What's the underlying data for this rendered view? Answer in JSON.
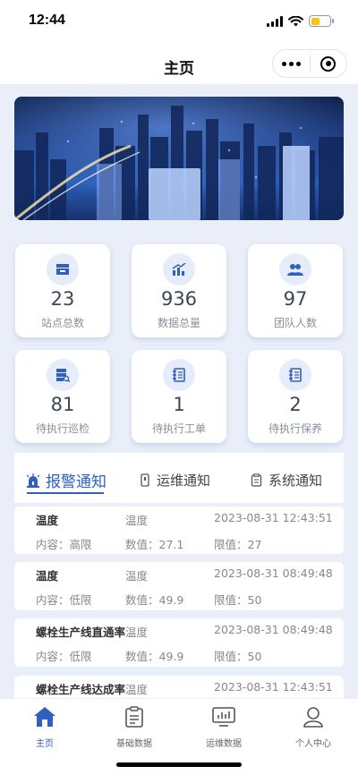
{
  "status_bar": {
    "time": "12:44"
  },
  "nav": {
    "title": "主页"
  },
  "stats": [
    {
      "value": "23",
      "label": "站点总数",
      "icon": "inbox-icon"
    },
    {
      "value": "936",
      "label": "数据总量",
      "icon": "chart-up-icon"
    },
    {
      "value": "97",
      "label": "团队人数",
      "icon": "team-icon"
    },
    {
      "value": "81",
      "label": "待执行巡检",
      "icon": "server-search-icon"
    },
    {
      "value": "1",
      "label": "待执行工单",
      "icon": "notebook-icon"
    },
    {
      "value": "2",
      "label": "待执行保养",
      "icon": "notebook-icon"
    }
  ],
  "notice_tabs": [
    {
      "label": "报警通知",
      "icon": "alarm-light-icon",
      "active": true
    },
    {
      "label": "运维通知",
      "icon": "phone-icon",
      "active": false
    },
    {
      "label": "系统通知",
      "icon": "clipboard-icon",
      "active": false
    }
  ],
  "notices": [
    {
      "title": "温度",
      "type": "温度",
      "time": "2023-08-31 12:43:51",
      "content": "内容：高限",
      "value": "数值：27.1",
      "limit": "限值：27"
    },
    {
      "title": "温度",
      "type": "温度",
      "time": "2023-08-31 08:49:48",
      "content": "内容：低限",
      "value": "数值：49.9",
      "limit": "限值：50"
    },
    {
      "title": "螺栓生产线直通率",
      "type": "温度",
      "time": "2023-08-31 08:49:48",
      "content": "内容：低限",
      "value": "数值：49.9",
      "limit": "限值：50"
    },
    {
      "title": "螺栓生产线达成率",
      "type": "温度",
      "time": "2023-08-31 12:43:51"
    }
  ],
  "tab_bar": [
    {
      "label": "主页",
      "icon": "home-icon",
      "active": true
    },
    {
      "label": "基础数据",
      "icon": "clipboard-icon",
      "active": false
    },
    {
      "label": "运维数据",
      "icon": "monitor-chart-icon",
      "active": false
    },
    {
      "label": "个人中心",
      "icon": "user-icon",
      "active": false
    }
  ],
  "colors": {
    "accent": "#2f5fbf",
    "background": "#e9eef8",
    "icon_bg": "#e6ecf9"
  }
}
